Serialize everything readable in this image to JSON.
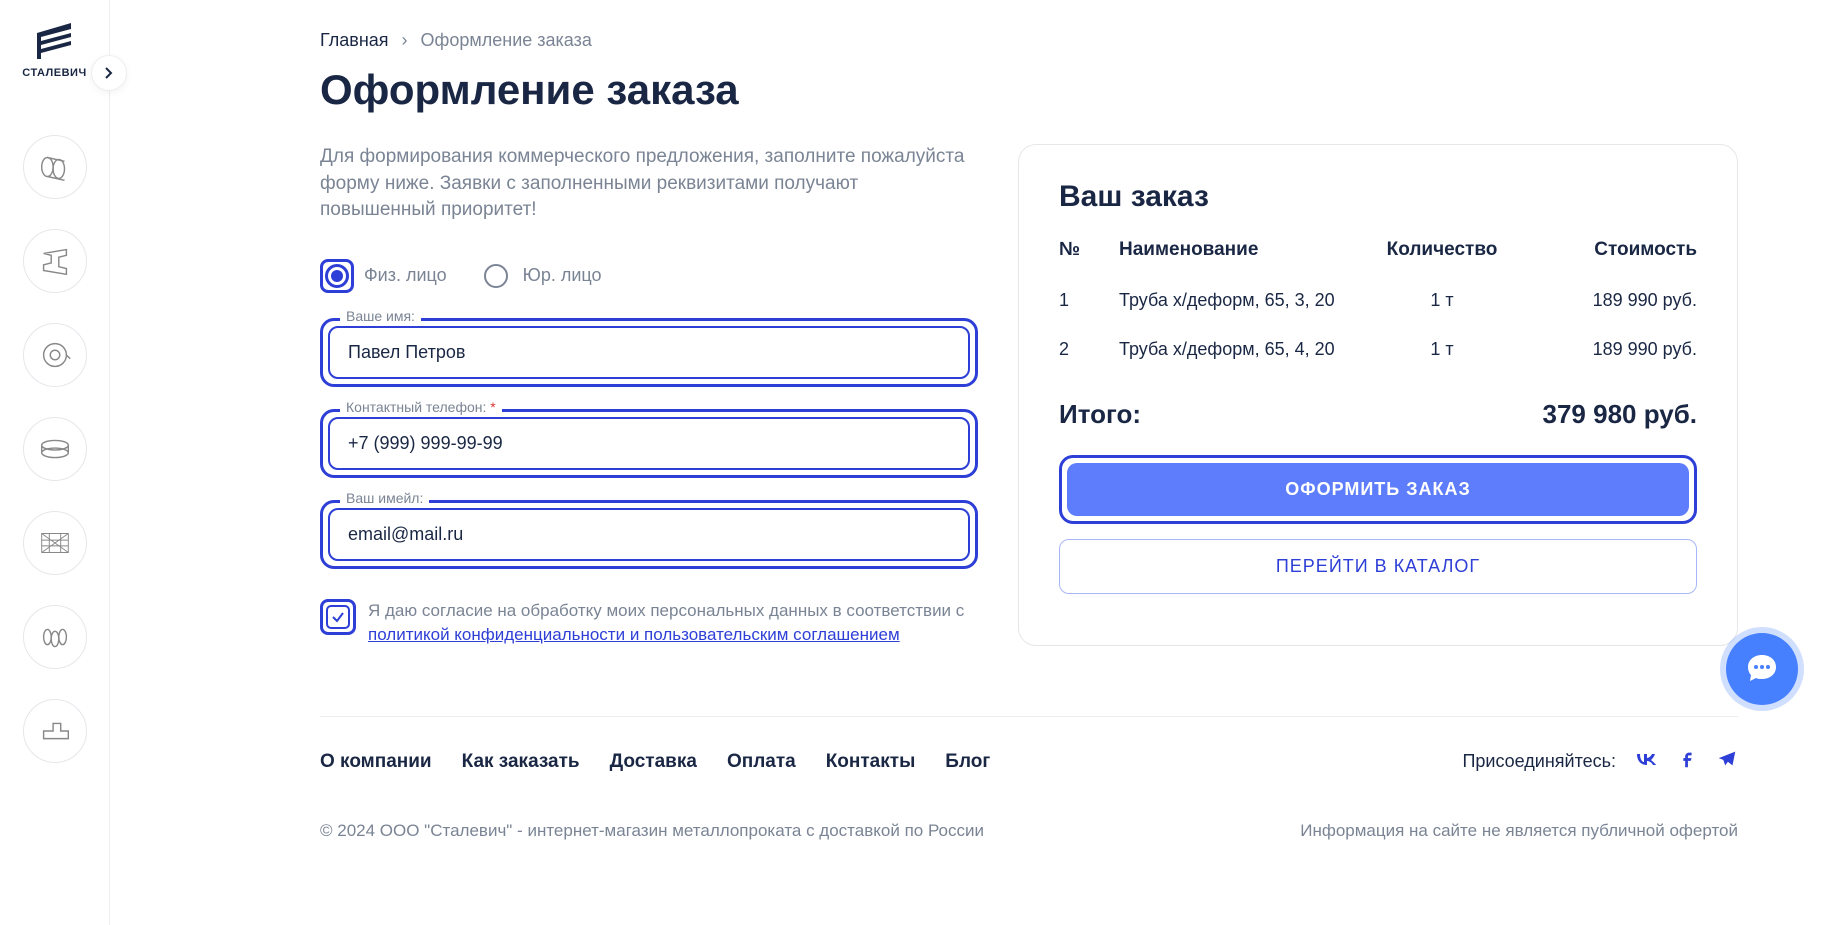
{
  "logo_text": "СТАЛЕВИЧ",
  "breadcrumb": {
    "home": "Главная",
    "current": "Оформление заказа"
  },
  "page_title": "Оформление заказа",
  "intro": "Для формирования коммерческого предложения, заполните пожалуйста форму ниже. Заявки с заполненными реквизитами получают повышенный приоритет!",
  "radios": {
    "individual": "Физ. лицо",
    "company": "Юр. лицо"
  },
  "fields": {
    "name_label": "Ваше имя:",
    "name_value": "Павел Петров",
    "phone_label": "Контактный телефон: ",
    "phone_required": "*",
    "phone_value": "+7 (999) 999-99-99",
    "email_label": "Ваш имейл:",
    "email_value": "email@mail.ru"
  },
  "consent": {
    "text_prefix": "Я даю согласие на обработку моих персональных данных в соответствии с ",
    "link": "политикой конфиденциальности и пользовательским соглашением"
  },
  "order": {
    "title": "Ваш заказ",
    "headers": {
      "num": "№",
      "name": "Наименование",
      "qty": "Количество",
      "price": "Стоимость"
    },
    "items": [
      {
        "num": "1",
        "name": "Труба х/деформ, 65, 3, 20",
        "qty": "1 т",
        "price": "189 990 руб."
      },
      {
        "num": "2",
        "name": "Труба х/деформ, 65, 4, 20",
        "qty": "1 т",
        "price": "189 990 руб."
      }
    ],
    "total_label": "Итого:",
    "total_value": "379 980 руб.",
    "btn_submit": "ОФОРМИТЬ ЗАКАЗ",
    "btn_catalog": "ПЕРЕЙТИ В КАТАЛОГ"
  },
  "footer": {
    "links": [
      "О компании",
      "Как заказать",
      "Доставка",
      "Оплата",
      "Контакты",
      "Блог"
    ],
    "social_label": "Присоединяйтесь:",
    "copyright": "© 2024 ООО \"Сталевич\" - интернет-магазин металлопроката с доставкой по России",
    "disclaimer": "Информация на сайте не является публичной офертой"
  }
}
